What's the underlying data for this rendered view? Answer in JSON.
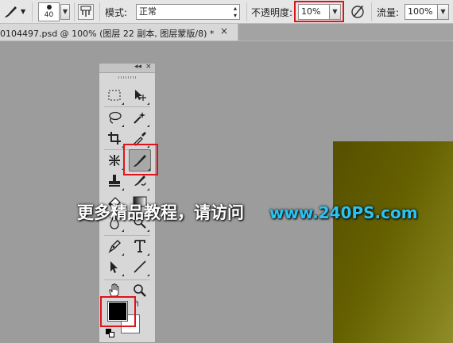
{
  "options_bar": {
    "brush_size": "40",
    "mode_label": "模式:",
    "mode_value": "正常",
    "opacity_label": "不透明度:",
    "opacity_value": "10%",
    "flow_label": "流量:",
    "flow_value": "100%"
  },
  "document_tab": {
    "title": "0104497.psd @ 100% (图层 22 副本, 图层蒙版/8) *",
    "close_glyph": "×"
  },
  "toolbox": {
    "collapse_glyph": "◂◂",
    "close_glyph": "×",
    "tools": [
      "rect-marquee",
      "move",
      "lasso",
      "magic-wand",
      "crop",
      "eyedropper",
      "healing",
      "brush",
      "clone-stamp",
      "history-brush",
      "eraser",
      "gradient",
      "blur",
      "dodge",
      "pen",
      "type",
      "path-select",
      "line",
      "hand",
      "zoom"
    ],
    "active_tool": "brush",
    "foreground_color": "#000000",
    "background_color": "#ffffff",
    "swap_glyph": "↰"
  },
  "canvas": {
    "gradient_colors": [
      "#565000",
      "#908c2a"
    ]
  },
  "watermark": {
    "chinese_text": "更多精品教程，请访问",
    "url_text": "www.240PS.com"
  },
  "highlight_color": "#e0131b"
}
